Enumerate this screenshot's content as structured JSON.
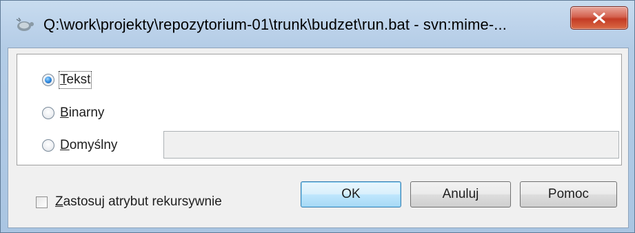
{
  "window": {
    "title": "Q:\\work\\projekty\\repozytorium-01\\trunk\\budzet\\run.bat - svn:mime-...",
    "app_icon": "tortoisesvn-icon",
    "close_icon": "close-icon"
  },
  "options": {
    "text_label": "Tekst",
    "text_selected": true,
    "binary_label": "Binarny",
    "binary_selected": false,
    "default_label": "Domyślny",
    "default_selected": false,
    "default_value": ""
  },
  "recursive": {
    "label": "Zastosuj atrybut rekursywnie",
    "checked": false
  },
  "buttons": {
    "ok": "OK",
    "cancel": "Anuluj",
    "help": "Pomoc"
  },
  "colors": {
    "close_button": "#c43b25",
    "radio_selected": "#2f8ae0",
    "default_button_border": "#3c7fb1"
  }
}
